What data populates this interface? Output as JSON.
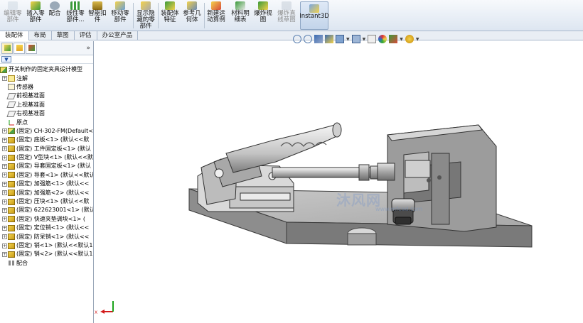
{
  "ribbon": {
    "buttons": [
      {
        "label": "编辑零\n部件",
        "icon": "edit-component-icon",
        "disabled": true
      },
      {
        "label": "插入零\n部件",
        "icon": "insert-components-icon",
        "dropdown": true
      },
      {
        "label": "配合",
        "icon": "mate-icon"
      },
      {
        "label": "线性零\n部件...",
        "icon": "linear-pattern-icon",
        "dropdown": true
      },
      {
        "label": "智能扣\n件",
        "icon": "smart-fasteners-icon"
      },
      {
        "label": "移动零\n部件",
        "icon": "move-component-icon",
        "dropdown": true
      },
      {
        "label": "显示隐\n藏的零\n部件",
        "icon": "show-hidden-components-icon"
      },
      {
        "label": "装配体\n特征",
        "icon": "assembly-features-icon",
        "dropdown": true
      },
      {
        "label": "参考几\n何体",
        "icon": "reference-geometry-icon",
        "dropdown": true
      },
      {
        "label": "新建运\n动算例",
        "icon": "new-motion-study-icon"
      },
      {
        "label": "材料明\n细表",
        "icon": "bill-of-materials-icon"
      },
      {
        "label": "爆炸视\n图",
        "icon": "exploded-view-icon"
      },
      {
        "label": "爆炸直\n线草图",
        "icon": "explode-line-sketch-icon",
        "disabled": true
      },
      {
        "label": "Instant3D",
        "icon": "instant3d-icon",
        "active": true
      }
    ]
  },
  "tabs": [
    "装配体",
    "布局",
    "草图",
    "评估",
    "办公室产品"
  ],
  "panel": {
    "expand_glyph": "»",
    "filter_glyph": "▼",
    "root": "开关制作的固定夹具设计模型",
    "items": [
      {
        "label": "注解",
        "icon": "annotations-icon",
        "expand": true
      },
      {
        "label": "传感器",
        "icon": "sensors-icon",
        "expand": false
      },
      {
        "label": "前视基准面",
        "icon": "plane-icon",
        "expand": false
      },
      {
        "label": "上视基准面",
        "icon": "plane-icon",
        "expand": false
      },
      {
        "label": "右视基准面",
        "icon": "plane-icon",
        "expand": false
      },
      {
        "label": "原点",
        "icon": "origin-icon",
        "expand": false
      },
      {
        "label": "(固定) CH-302-FM(Default<",
        "icon": "subassembly-icon",
        "expand": true
      },
      {
        "label": "(固定) 底板<1> (默认<<默",
        "icon": "part-icon",
        "expand": true
      },
      {
        "label": "(固定) 工件固定板<1> (默认",
        "icon": "part-icon",
        "expand": true
      },
      {
        "label": "(固定) V型块<1> (默认<<默",
        "icon": "part-icon",
        "expand": true
      },
      {
        "label": "(固定) 导套固定板<1> (默认",
        "icon": "part-icon",
        "expand": true
      },
      {
        "label": "(固定) 导套<1> (默认<<默认",
        "icon": "part-icon",
        "expand": true
      },
      {
        "label": "(固定) 加强筋<1> (默认<<",
        "icon": "part-icon",
        "expand": true
      },
      {
        "label": "(固定) 加强筋<2> (默认<<",
        "icon": "part-icon",
        "expand": true
      },
      {
        "label": "(固定) 压块<1> (默认<<默",
        "icon": "part-icon",
        "expand": true
      },
      {
        "label": "(固定) 622623001<1> (默认<",
        "icon": "part-icon",
        "expand": true
      },
      {
        "label": "(固定) 快速夹垫调块<1> (",
        "icon": "part-icon",
        "expand": true
      },
      {
        "label": "(固定) 定位销<1> (默认<<",
        "icon": "part-icon",
        "expand": true
      },
      {
        "label": "(固定) 防呆销<1> (默认<<",
        "icon": "part-icon",
        "expand": true
      },
      {
        "label": "(固定) 销<1> (默认<<默认1",
        "icon": "part-icon",
        "expand": true
      },
      {
        "label": "(固定) 销<2> (默认<<默认1",
        "icon": "part-icon",
        "expand": true
      },
      {
        "label": "配合",
        "icon": "mates-icon",
        "expand": false
      }
    ]
  },
  "watermark": {
    "text": "沐风网",
    "url": "www.mfcad.com"
  },
  "colors": {
    "ribbon_bg": "#dde6f1",
    "model_steel": "#9a9a9a",
    "model_dark": "#555555",
    "grip_gray": "#c8c8c8"
  }
}
